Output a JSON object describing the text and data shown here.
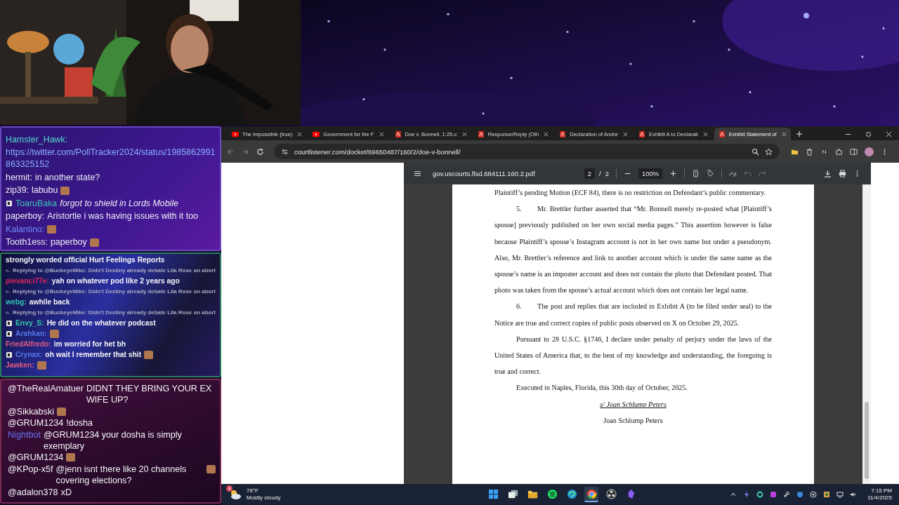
{
  "chat_panels": [
    {
      "kind": "standard",
      "messages": [
        {
          "kind": "link",
          "user": "Hamster_Hawk:",
          "color": "#4fd6c8",
          "text": "https://twitter.com/PollTracker2024/status/1985862991863325152",
          "emote": false,
          "badge": false
        },
        {
          "kind": "message",
          "user": "hermit:",
          "color": "#ececf4",
          "text": "in another state?",
          "emote": false,
          "badge": false
        },
        {
          "kind": "message",
          "user": "zip39:",
          "color": "#ececf4",
          "text": "labubu",
          "emote": true,
          "badge": false
        },
        {
          "kind": "action",
          "user": "ToaruBaka",
          "color": "#3cc4b4",
          "text": "forgot to shield in Lords Mobile",
          "emote": false,
          "badge": true
        },
        {
          "kind": "message",
          "user": "paperboy:",
          "color": "#ececf4",
          "text": "Aristortle i was having issues with it too",
          "emote": false,
          "badge": false
        },
        {
          "kind": "message",
          "user": "Kalantino:",
          "color": "#6e8cf5",
          "emote": true,
          "badge": false
        },
        {
          "kind": "message",
          "user": "Tooth1ess:",
          "color": "#ececf4",
          "text": "paperboy",
          "emote": true,
          "badge": false
        }
      ]
    },
    {
      "kind": "compact",
      "messages": [
        {
          "kind": "plain",
          "text": "strongly worded official Hurt Feelings Reports"
        },
        {
          "kind": "reply",
          "text": "Replying to @BuckeyeMike: Didn't Destiny already debate Lila Rose on abort"
        },
        {
          "kind": "message",
          "user": "pievanci77e:",
          "color": "#d8285a",
          "text": "yah on whatever pod like 2 years ago",
          "emote": false,
          "badge": false
        },
        {
          "kind": "reply",
          "text": "Replying to @BuckeyeMike: Didn't Destiny already debate Lila Rose on abort"
        },
        {
          "kind": "message",
          "user": "webg:",
          "color": "#34c4b4",
          "text": "awhile back",
          "emote": false,
          "badge": false
        },
        {
          "kind": "reply",
          "text": "Replying to @BuckeyeMike: Didn't Destiny already debate Lila Rose on abort"
        },
        {
          "kind": "message",
          "user": "Envy_S:",
          "color": "#34c4a8",
          "text": "He did on the whatever podcast",
          "emote": false,
          "badge": true
        },
        {
          "kind": "message",
          "user": "Arahkan:",
          "color": "#5878e8",
          "emote": true,
          "badge": true
        },
        {
          "kind": "message",
          "user": "FriedAlfredo:",
          "color": "#e05a82",
          "text": "im worried for het bh",
          "emote": false,
          "badge": false
        },
        {
          "kind": "message",
          "user": "Crynax:",
          "color": "#5878e8",
          "text": "oh wait I remember that shit",
          "emote": true,
          "badge": true
        },
        {
          "kind": "message",
          "user": "Jawken:",
          "color": "#e05a82",
          "emote": true,
          "badge": false
        }
      ]
    },
    {
      "kind": "large",
      "messages": [
        {
          "kind": "message",
          "user": "@TheRealAmatuer",
          "color": "#f4f4f8",
          "text": "DIDNT THEY BRING YOUR EX WIFE UP?",
          "emote": false,
          "badge": false
        },
        {
          "kind": "message",
          "user": "@Sikkabski",
          "color": "#f4f4f8",
          "emote": true,
          "badge": false
        },
        {
          "kind": "message",
          "user": "@GRUM1234",
          "color": "#f4f4f8",
          "text": "!dosha",
          "emote": false,
          "badge": false
        },
        {
          "kind": "message",
          "user": "Nightbot",
          "color": "#6470f0",
          "text": "@GRUM1234 your dosha is simply exemplary",
          "emote": false,
          "badge": false
        },
        {
          "kind": "message",
          "user": "@GRUM1234",
          "color": "#f4f4f8",
          "emote": true,
          "badge": false
        },
        {
          "kind": "message",
          "user": "@KPop-x5f",
          "color": "#f4f4f8",
          "text": "@jenn isnt there like 20 channels covering elections?",
          "emote": true,
          "badge": false
        },
        {
          "kind": "message",
          "user": "@adalon378",
          "color": "#f4f4f8",
          "text": "xD",
          "emote": false,
          "badge": false
        }
      ]
    }
  ],
  "browser": {
    "tabs": [
      {
        "kind": "video",
        "title": "The impossible (true)",
        "selected": false
      },
      {
        "kind": "video",
        "title": "Government for the F",
        "selected": false
      },
      {
        "kind": "pdf",
        "title": "Doe v. Bonnell, 1:25-c",
        "selected": false
      },
      {
        "kind": "pdf",
        "title": "Response/Reply (Oth",
        "selected": false
      },
      {
        "kind": "pdf",
        "title": "Declaration of Andre",
        "selected": false
      },
      {
        "kind": "pdf",
        "title": "Exhibit A to Declarati",
        "selected": false
      },
      {
        "kind": "pdf",
        "title": "Exhibit Statement of",
        "selected": true
      }
    ],
    "url": "courtlistener.com/docket/69650487/160/2/doe-v-bonnell/",
    "pdf_viewer": {
      "file_name": "gov.uscourts.flsd.684111.160.2.pdf",
      "page": "2",
      "page_separator": "/",
      "page_count": "2",
      "zoom": "100%",
      "paragraphs": [
        {
          "kind": "plain",
          "text": "Plaintiff’s pending Motion (ECF 84), there is no restriction on Defendant’s public commentary."
        },
        {
          "kind": "numbered",
          "number": "5.",
          "text": "Mr. Brettler further asserted that “Mr. Bonnell merely re-posted what [Plaintiff’s spouse] previously published on her own social media pages.” This assertion however is false because Plaintiff’s spouse’s Instagram account is not in her own name but under a pseudonym. Also, Mr. Brettler’s reference and link to another account which is under the same name as the spouse’s name is an imposter account and does not contain the photo that Defendant posted. That photo was taken from the spouse’s actual account which does not contain her legal name."
        },
        {
          "kind": "numbered",
          "number": "6.",
          "text": "The post and replies that are included in Exhibit A (to be filed under seal) to the Notice are true and correct copies of public posts observed on X on October 29, 2025."
        },
        {
          "kind": "indented",
          "text": "Pursuant to 28 U.S.C. §1746, I declare under penalty of perjury under the laws of the United States of America that, to the best of my knowledge and understanding, the foregoing is true and correct."
        },
        {
          "kind": "indented",
          "text": "Executed in Naples, Florida, this 30th day of October, 2025."
        },
        {
          "kind": "signature",
          "text": "s/ Joan Schlump Peters"
        },
        {
          "kind": "centered",
          "text": "Joan Schlump Peters"
        }
      ]
    }
  },
  "taskbar": {
    "weather": {
      "temperature": "78°F",
      "condition": "Mostly cloudy",
      "notification_count": "4"
    },
    "apps": [
      {
        "kind": "start",
        "selected": false
      },
      {
        "kind": "task-view",
        "selected": false
      },
      {
        "kind": "folder",
        "selected": false
      },
      {
        "kind": "music",
        "selected": false
      },
      {
        "kind": "swirl",
        "selected": false
      },
      {
        "kind": "browser",
        "selected": true
      },
      {
        "kind": "aperture",
        "selected": false
      },
      {
        "kind": "crystal",
        "selected": false
      }
    ],
    "time": "7:15 PM",
    "date": "11/4/2025"
  }
}
